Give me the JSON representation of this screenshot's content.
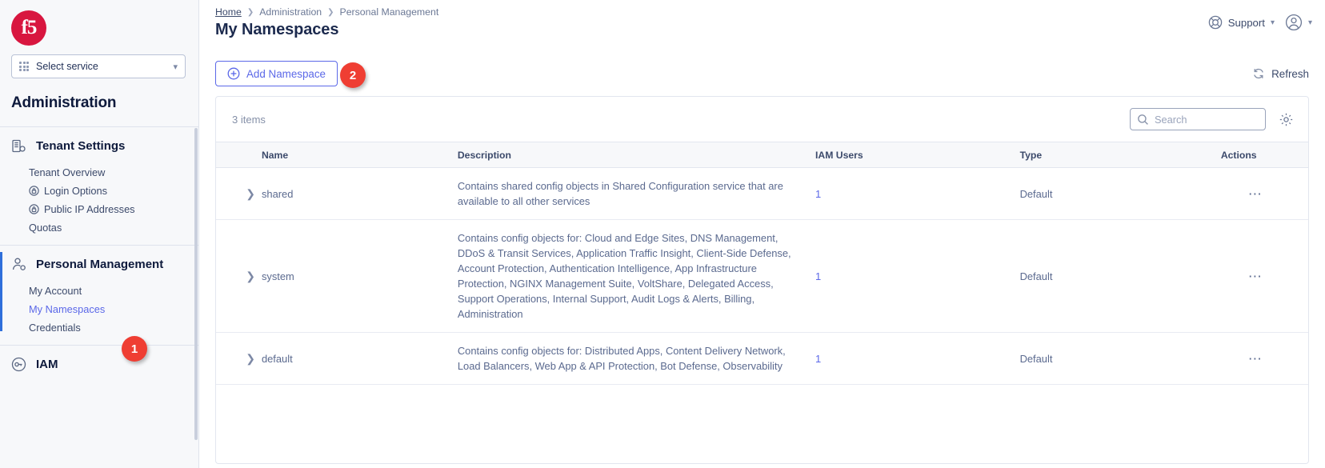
{
  "brand": {
    "logo_text": "f5",
    "accent": "#d8163f",
    "link_color": "#5b68e8",
    "badge_color": "#ef3e33"
  },
  "sidebar": {
    "service_select": {
      "label": "Select service",
      "icon": "grid-apps-icon",
      "chevron": "chevron-down-icon"
    },
    "section_title": "Administration",
    "groups": [
      {
        "label": "Tenant Settings",
        "icon": "building-gear-icon",
        "active": false,
        "items": [
          {
            "label": "Tenant Overview",
            "icon": null
          },
          {
            "label": "Login Options",
            "icon": "lock-icon"
          },
          {
            "label": "Public IP Addresses",
            "icon": "lock-icon"
          },
          {
            "label": "Quotas",
            "icon": null
          }
        ]
      },
      {
        "label": "Personal Management",
        "icon": "user-gear-icon",
        "active": true,
        "items": [
          {
            "label": "My Account",
            "icon": null
          },
          {
            "label": "My Namespaces",
            "icon": null,
            "selected": true
          },
          {
            "label": "Credentials",
            "icon": null
          }
        ]
      },
      {
        "label": "IAM",
        "icon": "key-icon",
        "active": false,
        "items": []
      }
    ]
  },
  "header": {
    "breadcrumb": [
      "Home",
      "Administration",
      "Personal Management"
    ],
    "title": "My Namespaces",
    "support": {
      "label": "Support",
      "icon": "lifebuoy-icon",
      "chevron": "chevron-down-icon"
    },
    "account": {
      "icon": "user-circle-icon",
      "chevron": "chevron-down-icon"
    }
  },
  "toolbar": {
    "add_namespace_label": "Add Namespace",
    "add_namespace_icon": "plus-circle-icon",
    "refresh_label": "Refresh",
    "refresh_icon": "refresh-icon"
  },
  "annotations": [
    {
      "id": "1",
      "text": "1",
      "target": "my-namespaces-nav-item"
    },
    {
      "id": "2",
      "text": "2",
      "target": "add-namespace-button"
    }
  ],
  "table": {
    "items_count_label": "3 items",
    "search": {
      "placeholder": "Search",
      "value": "",
      "icon": "search-icon"
    },
    "settings_icon": "gear-icon",
    "columns": [
      "Name",
      "Description",
      "IAM Users",
      "Type",
      "Actions"
    ],
    "rows": [
      {
        "expand_icon": "chevron-right-icon",
        "name": "shared",
        "description": "Contains shared config objects in Shared Configuration service that are available to all other services",
        "iam_users": "1",
        "type": "Default",
        "actions_icon": "ellipsis-icon"
      },
      {
        "expand_icon": "chevron-right-icon",
        "name": "system",
        "description": "Contains config objects for: Cloud and Edge Sites, DNS Management, DDoS & Transit Services, Application Traffic Insight, Client-Side Defense, Account Protection, Authentication Intelligence, App Infrastructure Protection, NGINX Management Suite, VoltShare, Delegated Access, Support Operations, Internal Support, Audit Logs & Alerts, Billing, Administration",
        "iam_users": "1",
        "type": "Default",
        "actions_icon": "ellipsis-icon"
      },
      {
        "expand_icon": "chevron-right-icon",
        "name": "default",
        "description": "Contains config objects for: Distributed Apps, Content Delivery Network, Load Balancers, Web App & API Protection, Bot Defense, Observability",
        "iam_users": "1",
        "type": "Default",
        "actions_icon": "ellipsis-icon"
      }
    ]
  }
}
